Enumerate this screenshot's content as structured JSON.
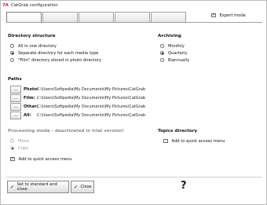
{
  "window": {
    "title": "CatGrab configuration",
    "app_icon": "7A"
  },
  "tabs": [
    {
      "label": ""
    },
    {
      "label": ""
    },
    {
      "label": ""
    },
    {
      "label": ""
    },
    {
      "label": ""
    }
  ],
  "expert_mode": {
    "label": "Expert mode",
    "checked": true
  },
  "directory_structure": {
    "heading": "Directory structure",
    "options": [
      {
        "label": "All in one directory",
        "checked": false
      },
      {
        "label": "Separate directory for each media type",
        "checked": true
      },
      {
        "label": "\"Film\" directory stored in photo directory",
        "checked": false
      }
    ]
  },
  "archiving": {
    "heading": "Archiving",
    "options": [
      {
        "label": "Monthly",
        "checked": false
      },
      {
        "label": "Quarterly",
        "checked": true
      },
      {
        "label": "Biannually",
        "checked": false
      }
    ]
  },
  "paths": {
    "heading": "Paths",
    "browse_label": "...",
    "rows": [
      {
        "key": "Photo:",
        "value": "C:\\Users\\Softpedia\\My Documents\\My Pictures\\CatGrab"
      },
      {
        "key": "Film:",
        "value": "C:\\Users\\Softpedia\\My Documents\\My Pictures\\CatGrab"
      },
      {
        "key": "Other:",
        "value": "C:\\Users\\Softpedia\\My Documents\\My Pictures\\CatGrab"
      },
      {
        "key": "All:",
        "value": "C:\\Users\\Softpedia\\My Documents\\My Pictures\\CatGrab"
      }
    ]
  },
  "processing_mode": {
    "heading": "Processing mode - deactivated in trial version!",
    "options": [
      {
        "label": "Move",
        "checked": false
      },
      {
        "label": "Copy",
        "checked": true
      }
    ],
    "quick_access": {
      "label": "Add to quick access menu",
      "checked": true
    }
  },
  "topics_directory": {
    "heading": "Topics directory",
    "quick_access": {
      "label": "Add to quick access menu",
      "checked": false
    }
  },
  "buttons": {
    "set_standard_close": "Set to standard and close",
    "close": "Close",
    "help": "?"
  }
}
